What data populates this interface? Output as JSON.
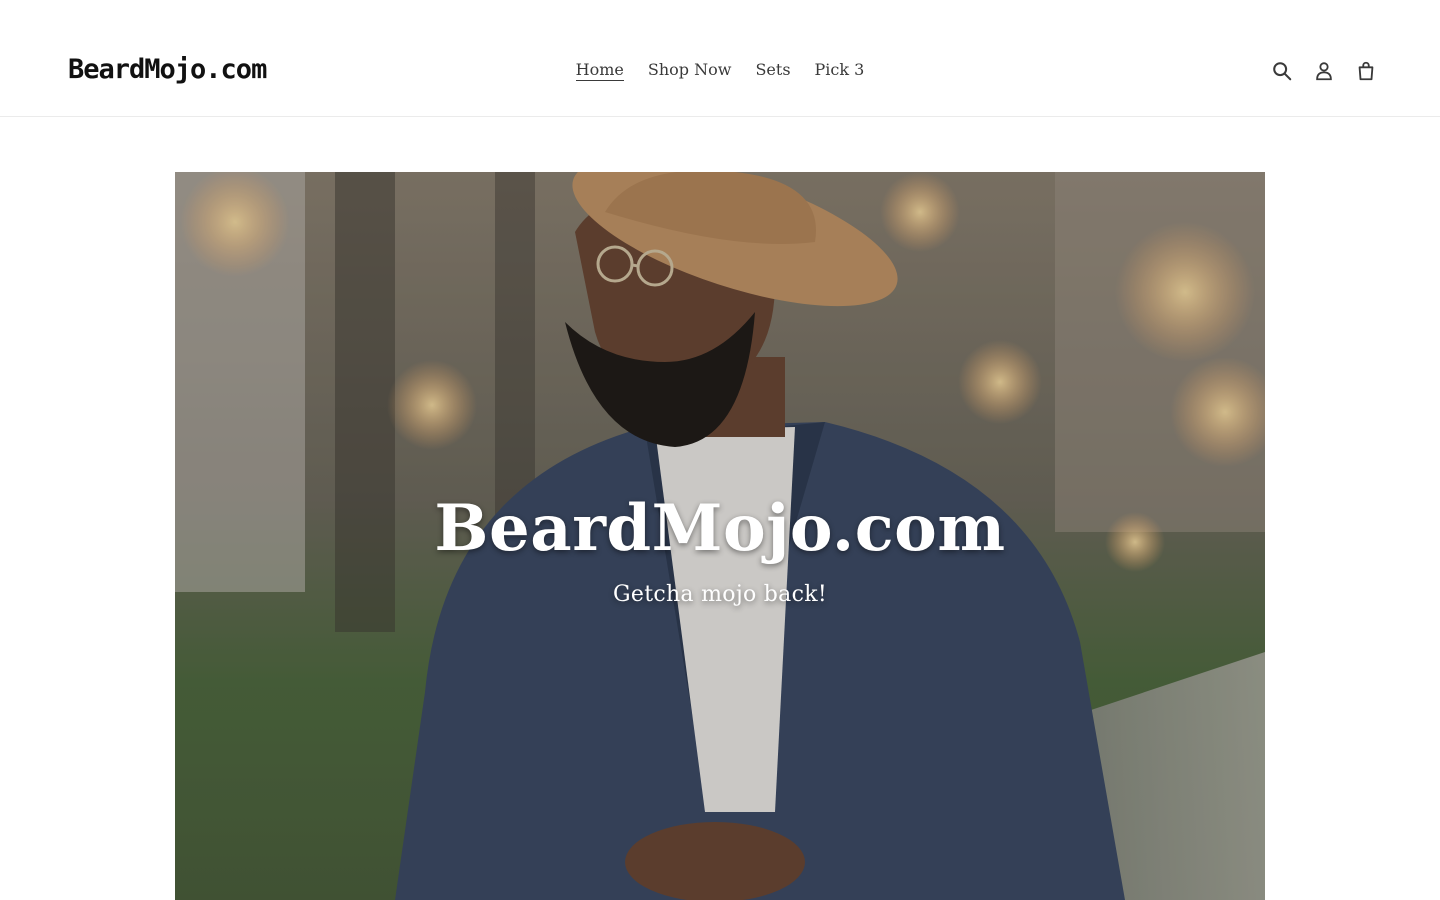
{
  "header": {
    "logo_text": "BeardMojo.com",
    "nav": [
      {
        "label": "Home",
        "active": true
      },
      {
        "label": "Shop Now",
        "active": false
      },
      {
        "label": "Sets",
        "active": false
      },
      {
        "label": "Pick 3",
        "active": false
      }
    ],
    "icons": [
      "search-icon",
      "account-icon",
      "cart-icon"
    ]
  },
  "hero": {
    "title": "BeardMojo.com",
    "subtitle": "Getcha mojo back!",
    "image_icon": "hero-photo"
  },
  "colors": {
    "text": "#3a3a3a",
    "hero_text": "#ffffff",
    "border": "#ebebeb"
  }
}
